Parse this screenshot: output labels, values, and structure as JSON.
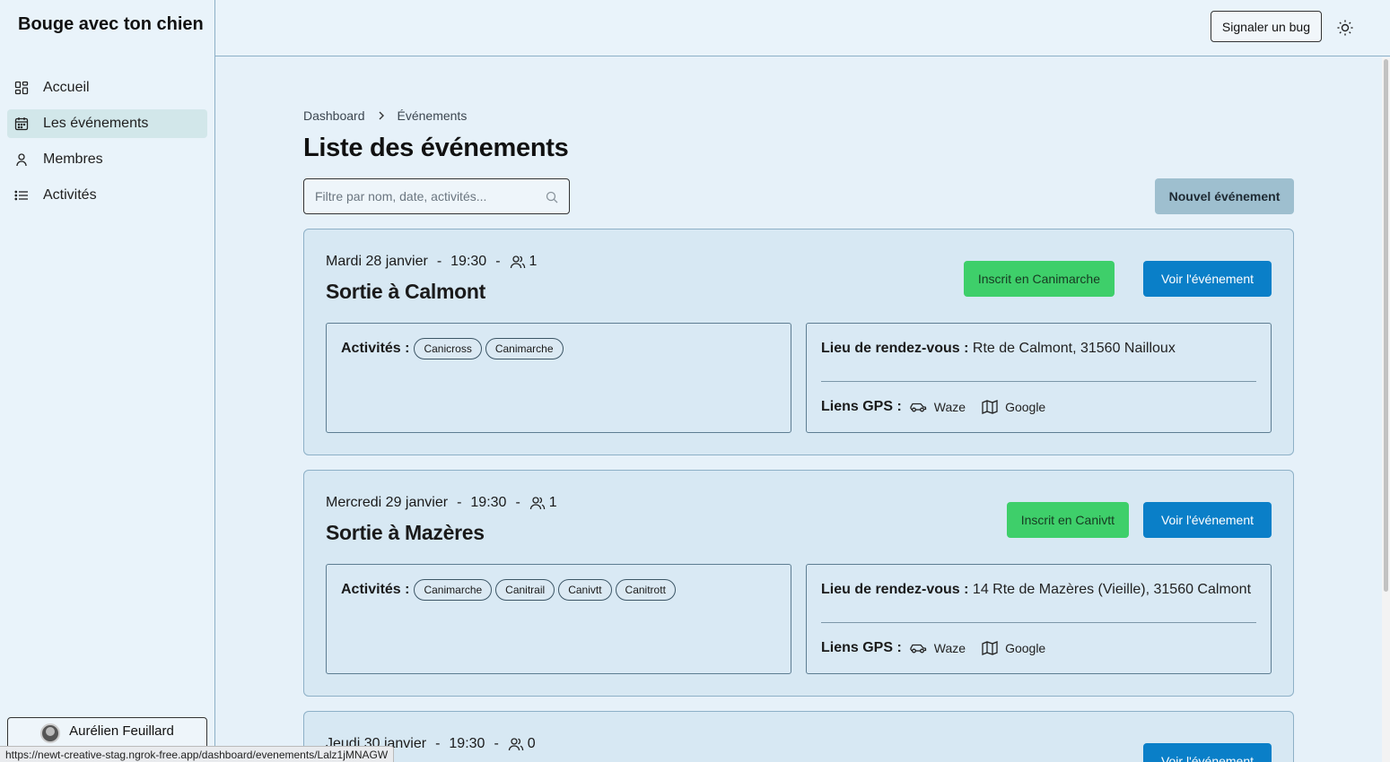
{
  "app": {
    "title": "Bouge avec ton chien"
  },
  "sidebar": {
    "items": [
      {
        "label": "Accueil",
        "icon": "dashboard-icon"
      },
      {
        "label": "Les événements",
        "icon": "calendar-icon",
        "active": true
      },
      {
        "label": "Membres",
        "icon": "user-icon"
      },
      {
        "label": "Activités",
        "icon": "list-icon"
      }
    ],
    "user": {
      "name": "Aurélien Feuillard"
    }
  },
  "topbar": {
    "bug_label": "Signaler un bug",
    "theme_icon": "sun-icon"
  },
  "breadcrumb": {
    "root": "Dashboard",
    "current": "Événements"
  },
  "page": {
    "title": "Liste des événements",
    "search_placeholder": "Filtre par nom, date, activités...",
    "new_event_label": "Nouvel événement"
  },
  "labels": {
    "activities": "Activités :",
    "meeting_place": "Lieu de rendez-vous :",
    "gps_links": "Liens GPS :",
    "waze": "Waze",
    "google": "Google",
    "view_event": "Voir l'événement",
    "meta_dash": "-"
  },
  "events": [
    {
      "date": "Mardi 28 janvier",
      "time": "19:30",
      "participants": "1",
      "title": "Sortie à Calmont",
      "registered": "Inscrit en Canimarche",
      "activities": [
        "Canicross",
        "Canimarche"
      ],
      "location": "Rte de Calmont, 31560 Nailloux"
    },
    {
      "date": "Mercredi 29 janvier",
      "time": "19:30",
      "participants": "1",
      "title": "Sortie à Mazères",
      "registered": "Inscrit en Canivtt",
      "activities": [
        "Canimarche",
        "Canitrail",
        "Canivtt",
        "Canitrott"
      ],
      "location": "14 Rte de Mazères (Vieille), 31560 Calmont"
    },
    {
      "date": "Jeudi 30 janvier",
      "time": "19:30",
      "participants": "0"
    }
  ],
  "status_bar": {
    "url": "https://newt-creative-stag.ngrok-free.app/dashboard/evenements/Lalz1jMNAGW"
  },
  "colors": {
    "background": "#e6f1f9",
    "card": "#d7e8f3",
    "registered_green": "#3ecf6a",
    "view_blue": "#0a7fc8",
    "new_event_button": "#9ebfcf",
    "active_nav": "#d2e7ea"
  }
}
